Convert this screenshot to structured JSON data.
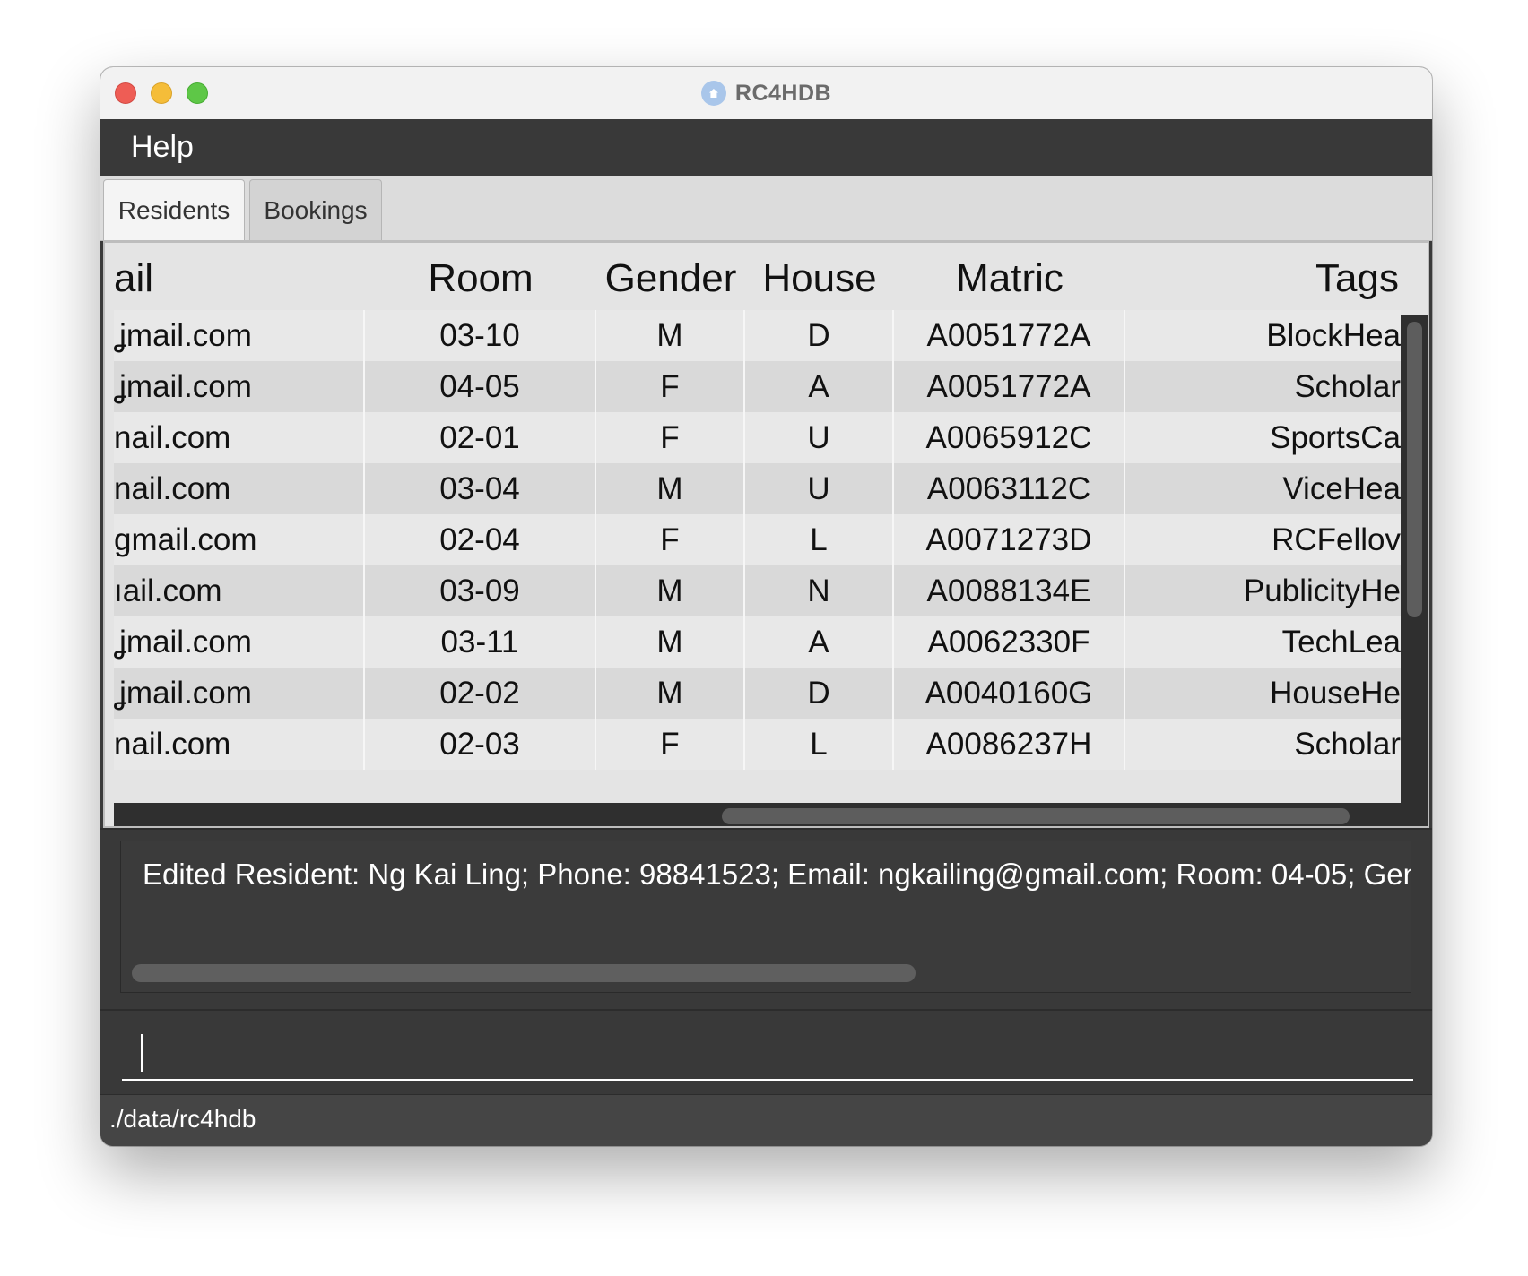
{
  "window": {
    "title": "RC4HDB",
    "app_icon": "house-icon"
  },
  "menu": {
    "items": [
      {
        "label": "Help"
      }
    ]
  },
  "tabs": [
    {
      "label": "Residents",
      "selected": true
    },
    {
      "label": "Bookings",
      "selected": false
    }
  ],
  "table": {
    "columns": [
      {
        "label": "ail"
      },
      {
        "label": "Room"
      },
      {
        "label": "Gender"
      },
      {
        "label": "House"
      },
      {
        "label": "Matric"
      },
      {
        "label": "Tags"
      }
    ],
    "rows": [
      {
        "email": "ʝmail.com",
        "room": "03-10",
        "gender": "M",
        "house": "D",
        "matric": "A0051772A",
        "tags": "BlockHea"
      },
      {
        "email": "ʝmail.com",
        "room": "04-05",
        "gender": "F",
        "house": "A",
        "matric": "A0051772A",
        "tags": "Scholar"
      },
      {
        "email": "nail.com",
        "room": "02-01",
        "gender": "F",
        "house": "U",
        "matric": "A0065912C",
        "tags": "SportsCa"
      },
      {
        "email": "nail.com",
        "room": "03-04",
        "gender": "M",
        "house": "U",
        "matric": "A0063112C",
        "tags": "ViceHea"
      },
      {
        "email": "gmail.com",
        "room": "02-04",
        "gender": "F",
        "house": "L",
        "matric": "A0071273D",
        "tags": "RCFellov"
      },
      {
        "email": "ıail.com",
        "room": "03-09",
        "gender": "M",
        "house": "N",
        "matric": "A0088134E",
        "tags": "PublicityHe"
      },
      {
        "email": "ʝmail.com",
        "room": "03-11",
        "gender": "M",
        "house": "A",
        "matric": "A0062330F",
        "tags": "TechLea"
      },
      {
        "email": "ʝmail.com",
        "room": "02-02",
        "gender": "M",
        "house": "D",
        "matric": "A0040160G",
        "tags": "HouseHe"
      },
      {
        "email": "nail.com",
        "room": "02-03",
        "gender": "F",
        "house": "L",
        "matric": "A0086237H",
        "tags": "Scholar"
      }
    ]
  },
  "result": {
    "text": "Edited Resident: Ng Kai Ling; Phone: 98841523; Email: ngkailing@gmail.com; Room: 04-05; Genc"
  },
  "command": {
    "value": "",
    "placeholder": ""
  },
  "status": {
    "path": "./data/rc4hdb"
  }
}
